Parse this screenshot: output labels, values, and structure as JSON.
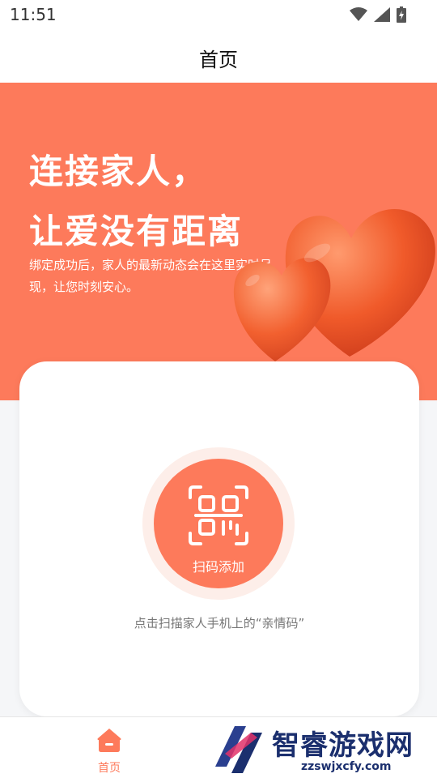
{
  "status_bar": {
    "time": "11:51",
    "icons": [
      "wifi-icon",
      "signal-icon",
      "battery-icon"
    ]
  },
  "header": {
    "title": "首页"
  },
  "hero": {
    "headline_line1": "连接家人，",
    "headline_line2": "让爱没有距离",
    "description": "绑定成功后，家人的最新动态会在这里实时呈现，让您时刻安心。",
    "background_color": "#fd7a5b",
    "illustration": "hearts-illustration"
  },
  "scan_card": {
    "button_label": "扫码添加",
    "hint": "点击扫描家人手机上的“亲情码”",
    "icon": "qr-scan-icon",
    "accent_color": "#fd7a5b"
  },
  "bottom_nav": {
    "items": [
      {
        "label": "首页",
        "icon": "home-icon",
        "active": true
      }
    ]
  },
  "watermark": {
    "title": "智睿游戏网",
    "url": "zzswjxcfy.com"
  }
}
